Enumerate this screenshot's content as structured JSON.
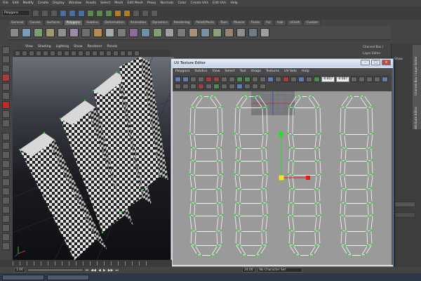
{
  "menubar": [
    "File",
    "Edit",
    "Modify",
    "Create",
    "Display",
    "Window",
    "Assets",
    "Select",
    "Mesh",
    "Edit Mesh",
    "Proxy",
    "Normals",
    "Color",
    "Create UVs",
    "Edit UVs",
    "Help"
  ],
  "mode_dropdown": "Polygons",
  "shelf_tabs": [
    "General",
    "Curves",
    "Surfaces",
    "Polygons",
    "Subdivs",
    "Deformation",
    "Animation",
    "Dynamics",
    "Rendering",
    "PaintEffects",
    "Toon",
    "Muscle",
    "Fluids",
    "Fur",
    "Hair",
    "nCloth",
    "Custom"
  ],
  "active_shelf_tab": "Polygons",
  "viewport_menu": [
    "View",
    "Shading",
    "Lighting",
    "Show",
    "Renderer",
    "Panels"
  ],
  "right_panel_label": "Channel Box / Layer Editor",
  "side_tabs": [
    "Channel Box / Layer Editor",
    "Attribute Editor"
  ],
  "right_panel_show": "Show",
  "uv_editor": {
    "title": "UV Texture Editor",
    "menu": [
      "Polygons",
      "Subdivs",
      "View",
      "Select",
      "Tool",
      "Image",
      "Textures",
      "UV Sets",
      "Help"
    ],
    "u_value": "-0.857",
    "v_value": "-0.667"
  },
  "timeline_start": "1.00",
  "range_end": "24.00",
  "auto_key": "No Character Set",
  "colors": {
    "uv_edge": "#f2f2f2",
    "uv_vertex": "#2bd62b",
    "uv_bg": "#9a9a9a",
    "manip_green": "#19e619",
    "manip_red": "#e61919",
    "manip_yellow": "#f2e619"
  }
}
